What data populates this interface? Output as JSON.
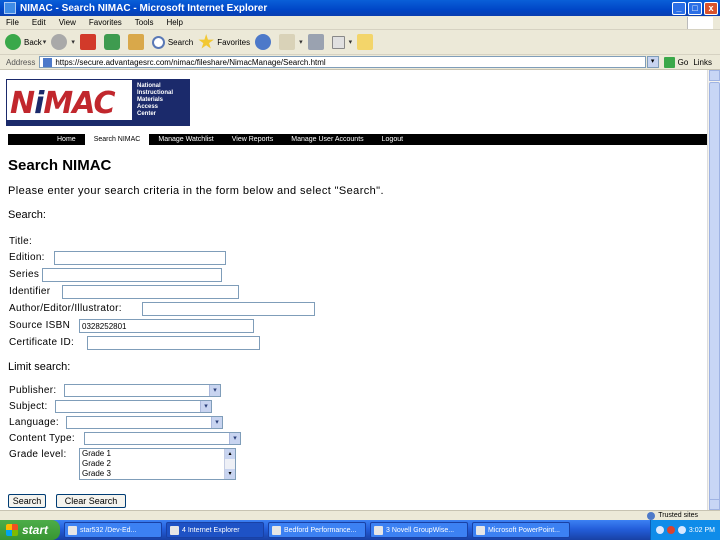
{
  "window": {
    "title": "NIMAC - Search NIMAC - Microsoft Internet Explorer",
    "minimize": "_",
    "maximize": "□",
    "close": "x"
  },
  "menu": [
    "File",
    "Edit",
    "View",
    "Favorites",
    "Tools",
    "Help"
  ],
  "toolbar": {
    "back_label": "Back",
    "search_label": "Search",
    "favorites_label": "Favorites"
  },
  "address": {
    "label": "Address",
    "url": "https://secure.advantagesrc.com/nimac/fileshare/NimacManage/Search.html",
    "go_label": "Go",
    "links_label": "Links"
  },
  "logo": {
    "wordmark_n": "N",
    "wordmark_i": "i",
    "wordmark_rest": "MAC",
    "side_text": [
      "National",
      "Instructional",
      "Materials",
      "Access",
      "Center"
    ]
  },
  "nav": [
    "Home",
    "Search NIMAC",
    "Manage Watchlist",
    "View Reports",
    "Manage User Accounts",
    "Logout"
  ],
  "page": {
    "title": "Search NIMAC",
    "intro": "Please enter your search criteria in the form below and select \"Search\".",
    "search_section": "Search:",
    "limit_section": "Limit search:"
  },
  "fields": {
    "title": {
      "label": "Title:",
      "value": ""
    },
    "edition": {
      "label": "Edition:",
      "value": ""
    },
    "series": {
      "label": "Series",
      "value": ""
    },
    "identifier": {
      "label": "Identifier",
      "value": ""
    },
    "author": {
      "label": "Author/Editor/Illustrator:",
      "value": ""
    },
    "source_isbn": {
      "label": "Source ISBN",
      "value": "0328252801"
    },
    "certificate": {
      "label": "Certificate ID:",
      "value": ""
    }
  },
  "limits": {
    "publisher": {
      "label": "Publisher:",
      "value": ""
    },
    "subject": {
      "label": "Subject:",
      "value": ""
    },
    "language": {
      "label": "Language:",
      "value": ""
    },
    "content_type": {
      "label": "Content Type:",
      "value": ""
    },
    "grade_level": {
      "label": "Grade level:",
      "options": [
        "Grade 1",
        "Grade 2",
        "Grade 3"
      ]
    }
  },
  "buttons": {
    "search": "Search",
    "clear": "Clear Search"
  },
  "status": {
    "zone": "Trusted sites"
  },
  "taskbar": {
    "start": "start",
    "items": [
      "star532 /Dev-Ed...",
      "4 Internet Explorer",
      "Bedford Performance...",
      "3 Novell GroupWise...",
      "Microsoft PowerPoint..."
    ],
    "clock": "3:02 PM"
  },
  "colors": {
    "nimac_red": "#c1272d",
    "nimac_navy": "#1b2a6b",
    "xp_blue": "#245edb",
    "xp_chrome": "#ece9d8"
  }
}
